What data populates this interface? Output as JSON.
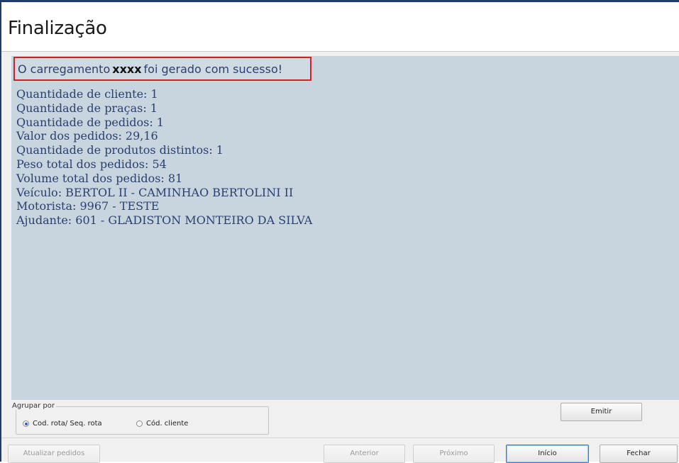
{
  "window": {
    "title": "Finalização"
  },
  "message": {
    "prefix": "O carregamento",
    "code": "xxxx",
    "suffix": "foi gerado com sucesso!"
  },
  "info": [
    "Quantidade de cliente: 1",
    "Quantidade de praças: 1",
    "Quantidade de pedidos: 1",
    "Valor dos pedidos: 29,16",
    "Quantidade de produtos distintos: 1",
    "Peso total dos pedidos: 54",
    "Volume total dos pedidos: 81",
    "Veículo: BERTOL II - CAMINHAO BERTOLINI II",
    "Motorista: 9967 - TESTE",
    "Ajudante: 601 - GLADISTON MONTEIRO DA SILVA"
  ],
  "group": {
    "label": "Agrupar por",
    "options": [
      {
        "label": "Cod. rota/ Seq. rota",
        "selected": true
      },
      {
        "label": "Cód. cliente",
        "selected": false
      }
    ]
  },
  "buttons": {
    "emitir": "Emitir",
    "atualizar": "Atualizar pedidos",
    "anterior": "Anterior",
    "proximo": "Próximo",
    "inicio": "Início",
    "fechar": "Fechar"
  },
  "colors": {
    "content_bg": "#c8d4de",
    "highlight_border": "#d0202a",
    "text": "#2b3f70",
    "window_border": "#1f3b70"
  }
}
